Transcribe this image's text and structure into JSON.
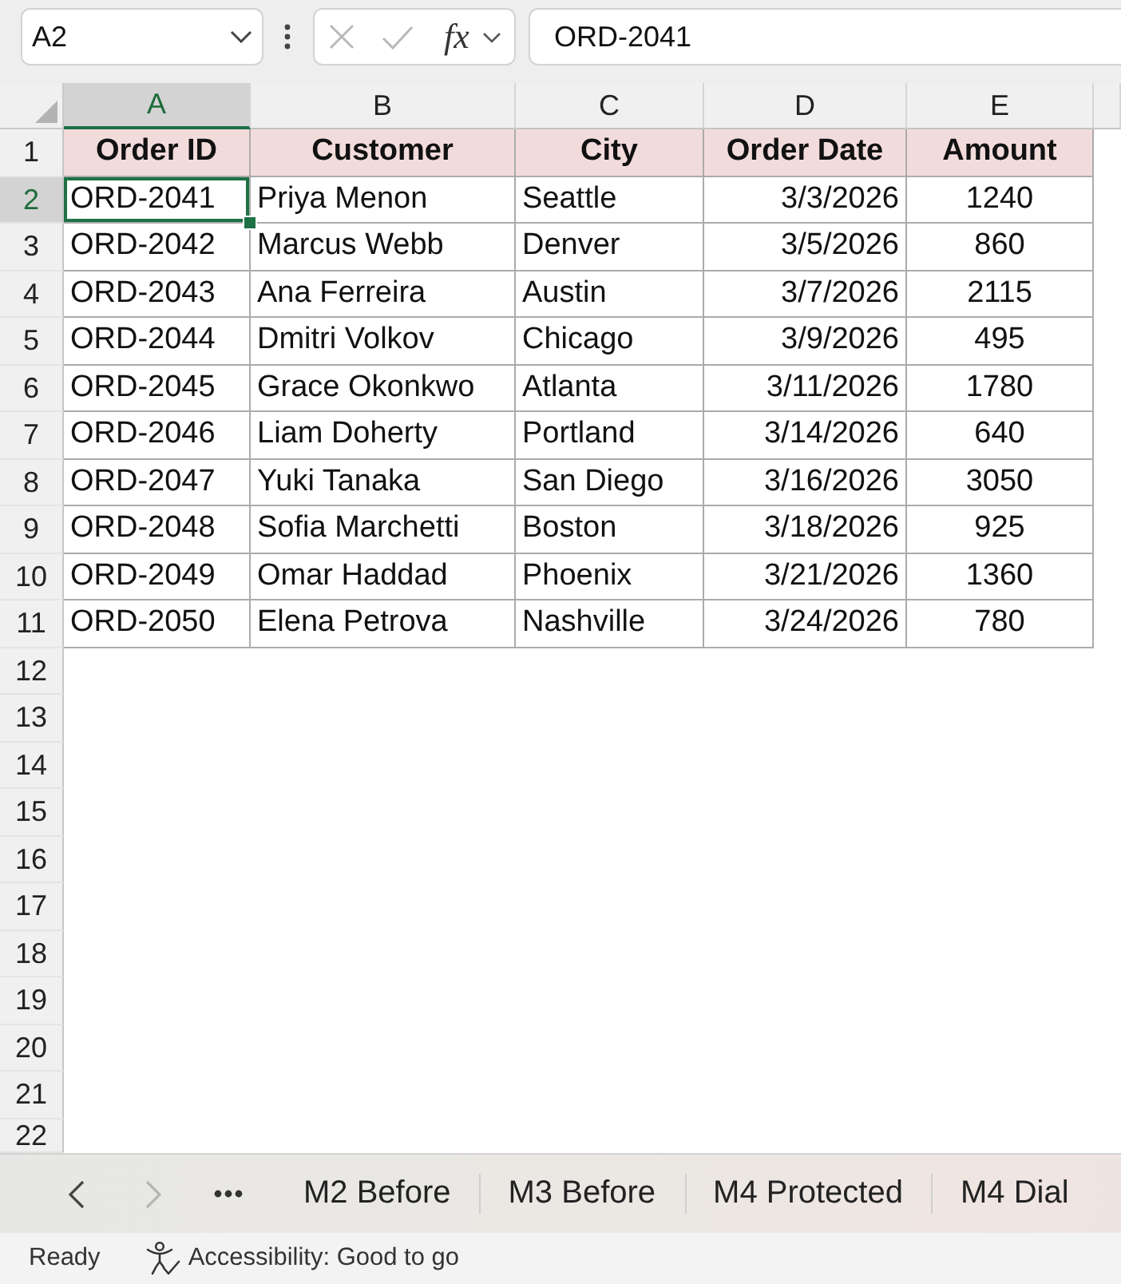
{
  "formula_bar": {
    "name_box": "A2",
    "editing": false,
    "function_label": "fx",
    "formula": "ORD-2041"
  },
  "grid": {
    "columns": [
      {
        "letter": "A",
        "selected": true
      },
      {
        "letter": "B",
        "selected": false
      },
      {
        "letter": "C",
        "selected": false
      },
      {
        "letter": "D",
        "selected": false
      },
      {
        "letter": "E",
        "selected": false
      }
    ],
    "rows": [
      {
        "number": "1",
        "kind": "header",
        "selected": false,
        "cells": [
          {
            "text": "Order ID",
            "selected": false
          },
          {
            "text": "Customer",
            "selected": false
          },
          {
            "text": "City",
            "selected": false
          },
          {
            "text": "Order Date",
            "selected": false
          },
          {
            "text": "Amount",
            "selected": false
          }
        ]
      },
      {
        "number": "2",
        "kind": "record",
        "selected": true,
        "cells": [
          {
            "text": "ORD-2041",
            "selected": true
          },
          {
            "text": "Priya Menon",
            "selected": false
          },
          {
            "text": "Seattle",
            "selected": false
          },
          {
            "text": "3/3/2026",
            "selected": false
          },
          {
            "text": "1240",
            "selected": false
          }
        ]
      },
      {
        "number": "3",
        "kind": "record",
        "selected": false,
        "cells": [
          {
            "text": "ORD-2042",
            "selected": false
          },
          {
            "text": "Marcus Webb",
            "selected": false
          },
          {
            "text": "Denver",
            "selected": false
          },
          {
            "text": "3/5/2026",
            "selected": false
          },
          {
            "text": "860",
            "selected": false
          }
        ]
      },
      {
        "number": "4",
        "kind": "record",
        "selected": false,
        "cells": [
          {
            "text": "ORD-2043",
            "selected": false
          },
          {
            "text": "Ana Ferreira",
            "selected": false
          },
          {
            "text": "Austin",
            "selected": false
          },
          {
            "text": "3/7/2026",
            "selected": false
          },
          {
            "text": "2115",
            "selected": false
          }
        ]
      },
      {
        "number": "5",
        "kind": "record",
        "selected": false,
        "cells": [
          {
            "text": "ORD-2044",
            "selected": false
          },
          {
            "text": "Dmitri Volkov",
            "selected": false
          },
          {
            "text": "Chicago",
            "selected": false
          },
          {
            "text": "3/9/2026",
            "selected": false
          },
          {
            "text": "495",
            "selected": false
          }
        ]
      },
      {
        "number": "6",
        "kind": "record",
        "selected": false,
        "cells": [
          {
            "text": "ORD-2045",
            "selected": false
          },
          {
            "text": "Grace Okonkwo",
            "selected": false
          },
          {
            "text": "Atlanta",
            "selected": false
          },
          {
            "text": "3/11/2026",
            "selected": false
          },
          {
            "text": "1780",
            "selected": false
          }
        ]
      },
      {
        "number": "7",
        "kind": "record",
        "selected": false,
        "cells": [
          {
            "text": "ORD-2046",
            "selected": false
          },
          {
            "text": "Liam Doherty",
            "selected": false
          },
          {
            "text": "Portland",
            "selected": false
          },
          {
            "text": "3/14/2026",
            "selected": false
          },
          {
            "text": "640",
            "selected": false
          }
        ]
      },
      {
        "number": "8",
        "kind": "record",
        "selected": false,
        "cells": [
          {
            "text": "ORD-2047",
            "selected": false
          },
          {
            "text": "Yuki Tanaka",
            "selected": false
          },
          {
            "text": "San Diego",
            "selected": false
          },
          {
            "text": "3/16/2026",
            "selected": false
          },
          {
            "text": "3050",
            "selected": false
          }
        ]
      },
      {
        "number": "9",
        "kind": "record",
        "selected": false,
        "cells": [
          {
            "text": "ORD-2048",
            "selected": false
          },
          {
            "text": "Sofia Marchetti",
            "selected": false
          },
          {
            "text": "Boston",
            "selected": false
          },
          {
            "text": "3/18/2026",
            "selected": false
          },
          {
            "text": "925",
            "selected": false
          }
        ]
      },
      {
        "number": "10",
        "kind": "record",
        "selected": false,
        "cells": [
          {
            "text": "ORD-2049",
            "selected": false
          },
          {
            "text": "Omar Haddad",
            "selected": false
          },
          {
            "text": "Phoenix",
            "selected": false
          },
          {
            "text": "3/21/2026",
            "selected": false
          },
          {
            "text": "1360",
            "selected": false
          }
        ]
      },
      {
        "number": "11",
        "kind": "record",
        "selected": false,
        "cells": [
          {
            "text": "ORD-2050",
            "selected": false
          },
          {
            "text": "Elena Petrova",
            "selected": false
          },
          {
            "text": "Nashville",
            "selected": false
          },
          {
            "text": "3/24/2026",
            "selected": false
          },
          {
            "text": "780",
            "selected": false
          }
        ]
      },
      {
        "number": "12",
        "kind": "blank",
        "selected": false
      },
      {
        "number": "13",
        "kind": "blank",
        "selected": false
      },
      {
        "number": "14",
        "kind": "blank",
        "selected": false
      },
      {
        "number": "15",
        "kind": "blank",
        "selected": false
      },
      {
        "number": "16",
        "kind": "blank",
        "selected": false
      },
      {
        "number": "17",
        "kind": "blank",
        "selected": false
      },
      {
        "number": "18",
        "kind": "blank",
        "selected": false
      },
      {
        "number": "19",
        "kind": "blank",
        "selected": false
      },
      {
        "number": "20",
        "kind": "blank",
        "selected": false
      },
      {
        "number": "21",
        "kind": "blank",
        "selected": false
      },
      {
        "number": "22",
        "kind": "blank",
        "selected": false
      }
    ]
  },
  "sheet_nav": {
    "previous_disabled": false,
    "next_disabled": true
  },
  "sheet_tabs": [
    {
      "label": "M2 Before",
      "selected": false
    },
    {
      "label": "M3 Before",
      "selected": false
    },
    {
      "label": "M4 Protected",
      "selected": false
    },
    {
      "label": "M4 Dial",
      "selected": false
    }
  ],
  "status_bar": {
    "mode": "Ready",
    "accessibility": "Accessibility: Good to go"
  }
}
